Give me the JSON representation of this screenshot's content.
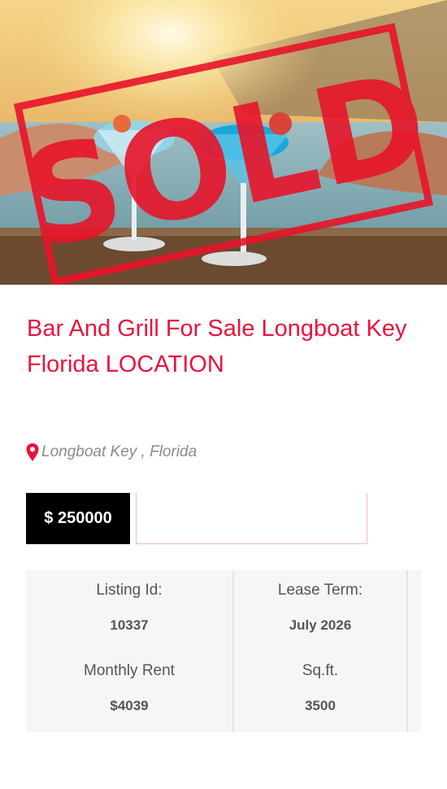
{
  "listing": {
    "stamp_text": "SOLD",
    "title": "Bar And Grill For Sale Longboat Key Florida LOCATION",
    "location": "Longboat Key , Florida",
    "price": "$ 250000",
    "details": {
      "listing_id_label": "Listing Id:",
      "listing_id_value": "10337",
      "lease_term_label": "Lease Term:",
      "lease_term_value": "July 2026",
      "monthly_rent_label": "Monthly Rent",
      "monthly_rent_value": "$4039",
      "sqft_label": "Sq.ft.",
      "sqft_value": "3500"
    }
  },
  "colors": {
    "accent": "#e8143c",
    "price_bg": "#000000",
    "table_bg": "#f6f6f6",
    "muted_text": "#8a8a8a",
    "label_text": "#555555"
  },
  "icons": {
    "location": "map-pin-icon"
  }
}
